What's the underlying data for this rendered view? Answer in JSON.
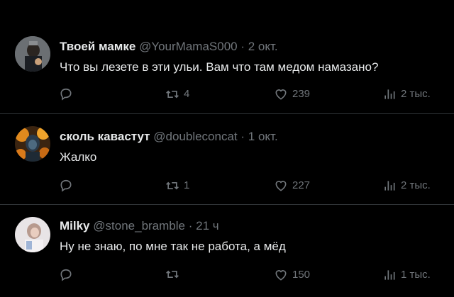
{
  "tweets": [
    {
      "name": "Твоей мамке",
      "handle": "@YourMamaS000",
      "dot": "·",
      "time": "2 окт.",
      "text": "Что вы лезете в эти ульи. Вам что там медом намазано?",
      "replies": "",
      "retweets": "4",
      "likes": "239",
      "views": "2 тыс."
    },
    {
      "name": "сколь кавастут",
      "handle": "@doubleconcat",
      "dot": "·",
      "time": "1 окт.",
      "text": "Жалко",
      "replies": "",
      "retweets": "1",
      "likes": "227",
      "views": "2 тыс."
    },
    {
      "name": "Milky",
      "handle": "@stone_bramble",
      "dot": "·",
      "time": "21 ч",
      "text": "Ну не знаю, по мне так не работа, а мёд",
      "replies": "",
      "retweets": "",
      "likes": "150",
      "views": "1 тыс."
    }
  ],
  "icons": {
    "reply": "reply-icon",
    "retweet": "retweet-icon",
    "like": "heart-icon",
    "views": "views-icon"
  },
  "colors": {
    "background": "#000000",
    "text": "#e7e9ea",
    "muted": "#71767b",
    "divider": "#2f3336"
  }
}
